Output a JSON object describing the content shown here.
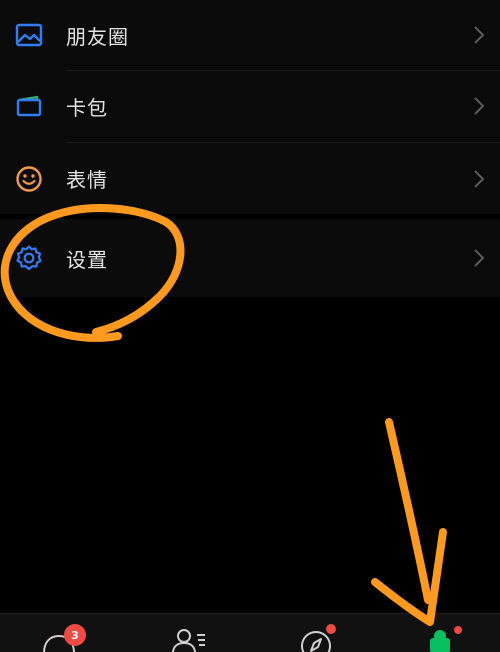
{
  "menu": {
    "items": [
      {
        "label": "朋友圈",
        "icon": "moments-icon",
        "color": "#2f7ef4"
      },
      {
        "label": "卡包",
        "icon": "card-wallet-icon",
        "color": "#2f7ef4"
      },
      {
        "label": "表情",
        "icon": "emoji-smile-icon",
        "color": "#f09a43"
      },
      {
        "label": "设置",
        "icon": "gear-icon",
        "color": "#2f7ef4"
      }
    ]
  },
  "tabbar": {
    "chats_badge": "3",
    "tabs": [
      "chat-bubble-icon",
      "contacts-icon",
      "discover-compass-icon",
      "me-person-icon"
    ],
    "active_color": "#07c160"
  },
  "annotation": {
    "color": "#ff9a1f",
    "shapes": [
      "circle-around-settings",
      "arrow-to-me-tab"
    ]
  }
}
